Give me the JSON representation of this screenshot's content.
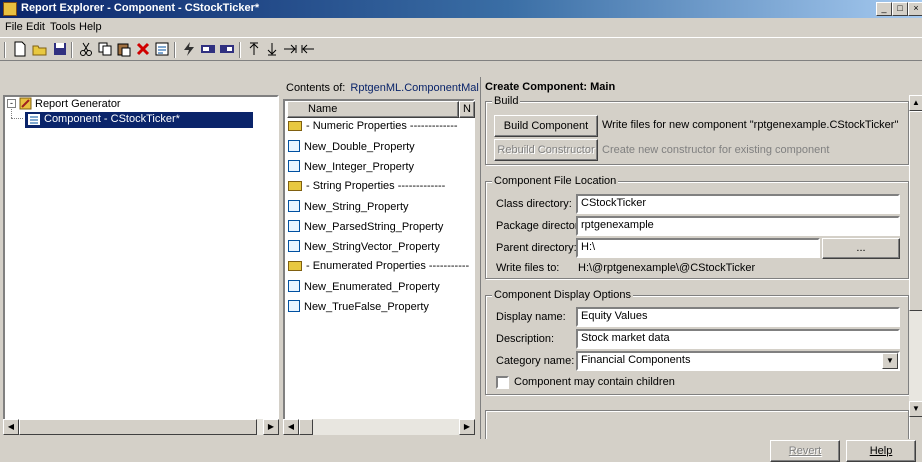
{
  "window": {
    "title": "Report Explorer - Component - CStockTicker*",
    "controls": [
      "_",
      "□",
      "×"
    ]
  },
  "menu": [
    "File",
    "Edit",
    "Tools",
    "Help"
  ],
  "toolbar": [
    "new-icon",
    "open-icon",
    "save-icon",
    "cut-icon",
    "copy-icon",
    "paste-icon",
    "delete-icon",
    "properties-icon",
    "run-icon",
    "report-icon",
    "report2-icon",
    "move-up-icon",
    "move-down-icon",
    "demote-icon",
    "promote-icon"
  ],
  "tree": {
    "root": "Report Generator",
    "child": "Component - CStockTicker*"
  },
  "contents": {
    "label": "Contents of:",
    "link": "RptgenML.ComponentMal",
    "column_name": "Name",
    "column_n": "N",
    "items": [
      {
        "type": "folder",
        "label": "- Numeric Properties -------------"
      },
      {
        "type": "prop",
        "label": "New_Double_Property"
      },
      {
        "type": "prop",
        "label": "New_Integer_Property"
      },
      {
        "type": "folder",
        "label": "- String Properties -------------"
      },
      {
        "type": "prop",
        "label": "New_String_Property"
      },
      {
        "type": "prop",
        "label": "New_ParsedString_Property"
      },
      {
        "type": "prop",
        "label": "New_StringVector_Property"
      },
      {
        "type": "folder",
        "label": "- Enumerated Properties -----------"
      },
      {
        "type": "prop",
        "label": "New_Enumerated_Property"
      },
      {
        "type": "prop",
        "label": "New_TrueFalse_Property"
      }
    ]
  },
  "panel": {
    "heading": "Create Component: Main",
    "build": {
      "legend": "Build",
      "build_button": "Build Component",
      "build_desc": "Write files for new component \"rptgenexample.CStockTicker\"",
      "rebuild_button": "Rebuild Constructor",
      "rebuild_desc": "Create new constructor for existing component"
    },
    "location": {
      "legend": "Component File Location",
      "class_label": "Class directory:",
      "class_value": "CStockTicker",
      "package_label": "Package directory:",
      "package_value": "rptgenexample",
      "parent_label": "Parent directory:",
      "parent_value": "H:\\",
      "browse_label": "...",
      "write_label": "Write files to:",
      "write_value": "H:\\@rptgenexample\\@CStockTicker"
    },
    "display": {
      "legend": "Component Display Options",
      "name_label": "Display name:",
      "name_value": "Equity Values",
      "desc_label": "Description:",
      "desc_value": "Stock market data",
      "category_label": "Category name:",
      "category_value": "Financial Components",
      "children_label": "Component may contain children"
    },
    "revert": "Revert",
    "help": "Help"
  }
}
